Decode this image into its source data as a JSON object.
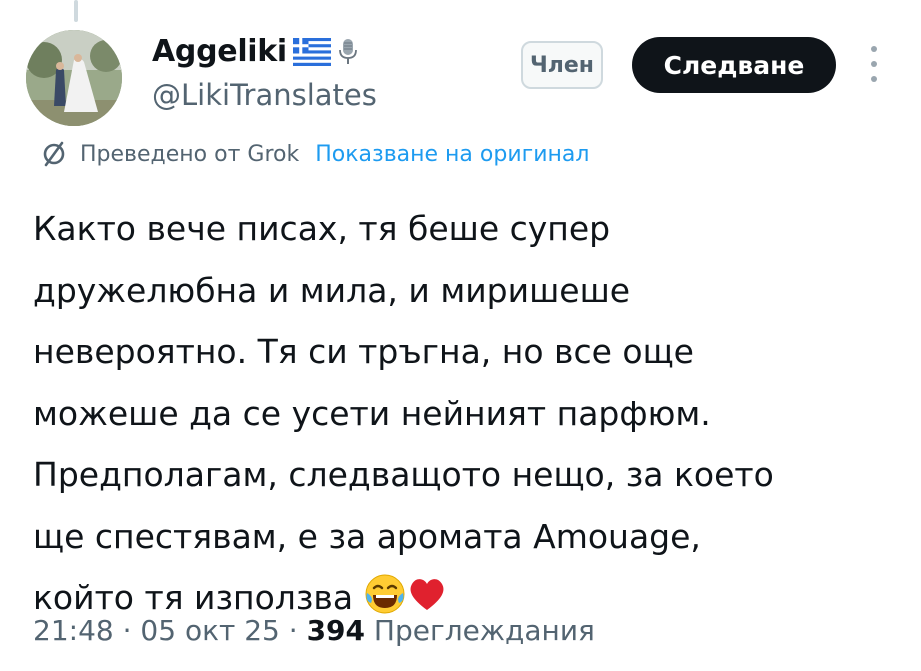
{
  "author": {
    "display_name": "Aggeliki",
    "handle": "@LikiTranslates",
    "flag_icon": "greece-flag-icon",
    "mic_icon": "microphone-icon"
  },
  "actions": {
    "member_label": "Член",
    "follow_label": "Следване",
    "more_icon": "more-vertical-icon"
  },
  "translation": {
    "translated_by": "Преведено от Grok",
    "show_original": "Показване на оригинал",
    "icon": "grok-icon"
  },
  "tweet": {
    "text": "Както вече писах, тя беше супер\nдружелюбна и мила, и миришеше\nневероятно. Тя си тръгна, но все още\nможеше да се усети нейният парфюм.\nПредполагам, следващото нещо, за което\nще спестявам, е за аромата Amouage,\nкойто тя използва",
    "emojis": [
      "laughing-tears-emoji",
      "red-heart-emoji"
    ]
  },
  "meta": {
    "time": "21:48",
    "date": "05 окт 25",
    "separator": "·",
    "views_count": "394",
    "views_label": "Преглеждания"
  },
  "colors": {
    "text_primary": "#0f1419",
    "text_secondary": "#536471",
    "link": "#1d9bf0",
    "button_dark": "#0f1419"
  }
}
